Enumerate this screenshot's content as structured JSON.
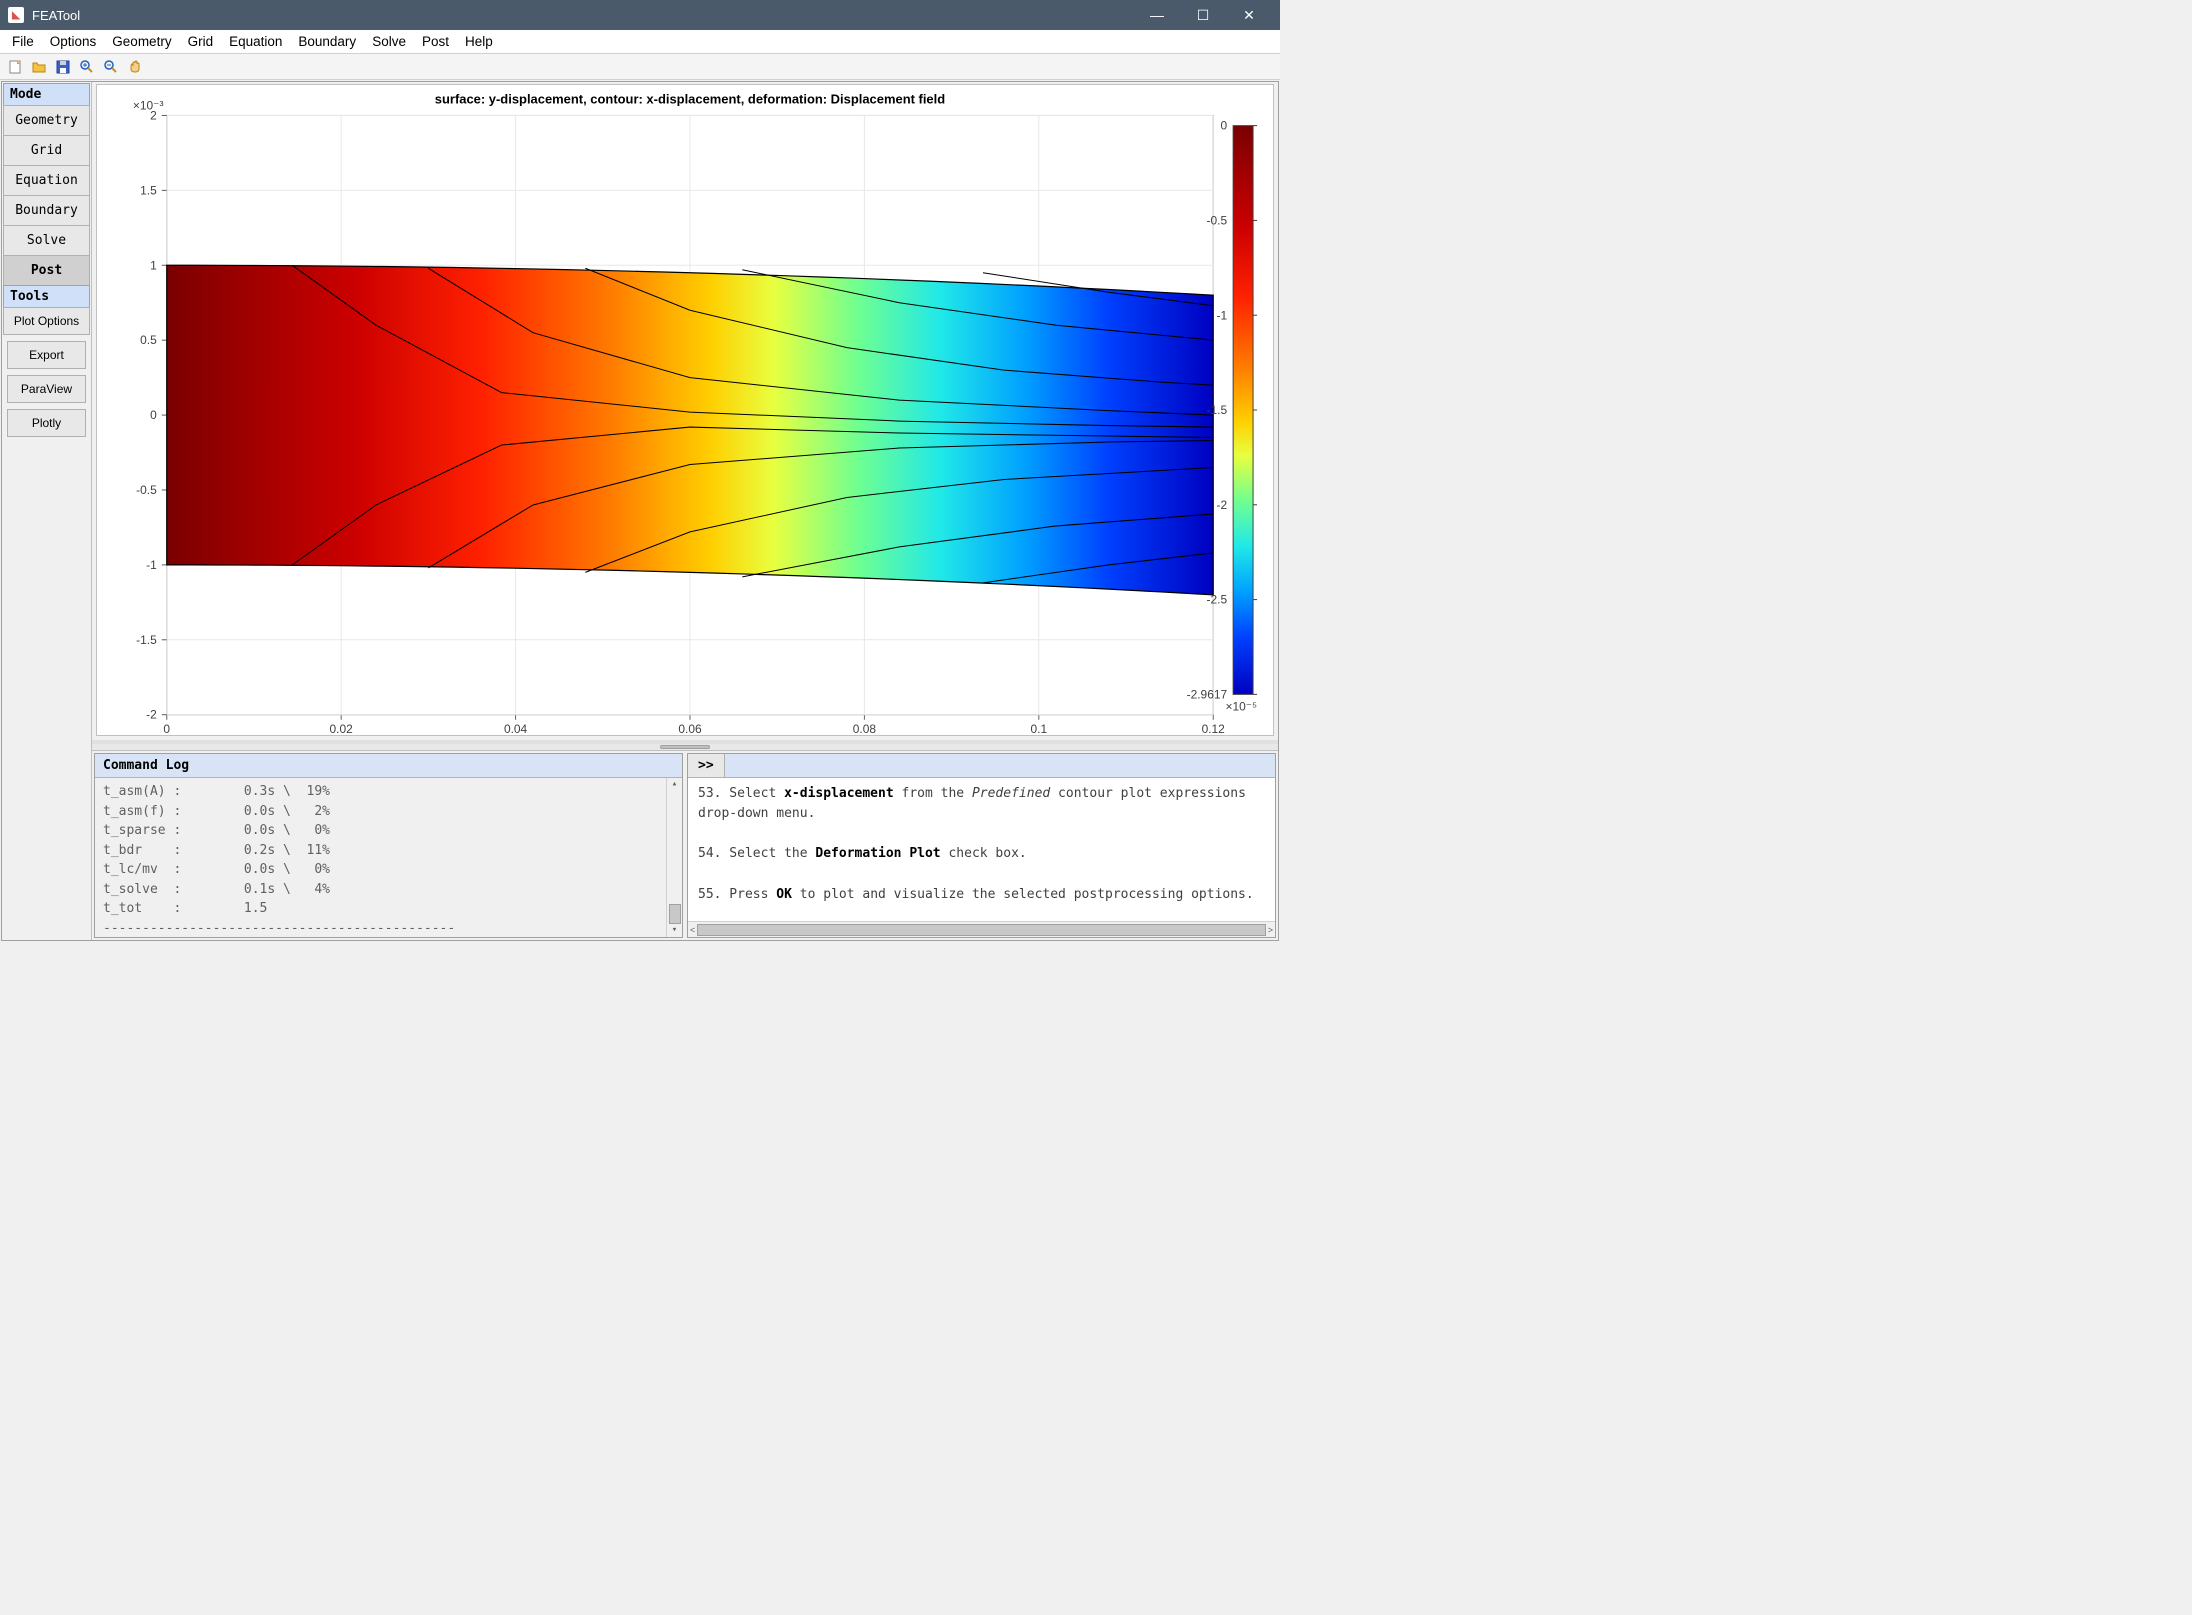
{
  "window": {
    "title": "FEATool"
  },
  "menu": [
    "File",
    "Options",
    "Geometry",
    "Grid",
    "Equation",
    "Boundary",
    "Solve",
    "Post",
    "Help"
  ],
  "sidebar": {
    "mode_label": "Mode",
    "modes": [
      "Geometry",
      "Grid",
      "Equation",
      "Boundary",
      "Solve",
      "Post"
    ],
    "active_mode": "Post",
    "tools_label": "Tools",
    "tools": [
      "Plot Options",
      "Export",
      "ParaView",
      "Plotly"
    ]
  },
  "plot": {
    "title": "surface: y-displacement, contour: x-displacement, deformation: Displacement field",
    "y_exponent": "×10⁻³",
    "cb_exponent": "×10⁻⁵",
    "x_ticks": [
      "0",
      "0.02",
      "0.04",
      "0.06",
      "0.08",
      "0.1",
      "0.12"
    ],
    "y_ticks": [
      "-2",
      "-1.5",
      "-1",
      "-0.5",
      "0",
      "0.5",
      "1",
      "1.5",
      "2"
    ],
    "cb_ticks": [
      "0",
      "-0.5",
      "-1",
      "-1.5",
      "-2",
      "-2.5",
      "-2.9617"
    ]
  },
  "command_log": {
    "header": "Command Log",
    "lines": [
      "t_asm(A) :        0.3s \\  19%",
      "t_asm(f) :        0.0s \\   2%",
      "t_sparse :        0.0s \\   0%",
      "t_bdr    :        0.2s \\  11%",
      "t_lc/mv  :        0.0s \\   0%",
      "t_solve  :        0.1s \\   4%",
      "t_tot    :        1.5",
      "---------------------------------------------"
    ]
  },
  "prompt": ">>",
  "help": {
    "p1_pre": "53. Select ",
    "p1_bold": "x-displacement",
    "p1_mid": " from the ",
    "p1_ital": "Predefined",
    "p1_post": " contour plot expressions drop-down menu.",
    "p2_pre": "54. Select the ",
    "p2_bold": "Deformation Plot",
    "p2_post": " check box.",
    "p3_pre": "55. Press ",
    "p3_bold": "OK",
    "p3_post": " to plot and visualize the selected postprocessing options."
  },
  "chart_data": {
    "type": "heatmap",
    "title": "surface: y-displacement, contour: x-displacement, deformation: Displacement field",
    "xlabel": "",
    "ylabel": "",
    "xlim": [
      0,
      0.12
    ],
    "ylim": [
      -0.002,
      0.002
    ],
    "colorbar_range": [
      -2.9617e-05,
      0
    ],
    "description": "Deformed beam colored by y-displacement with x-displacement isocontours",
    "x_ticks": [
      0,
      0.02,
      0.04,
      0.06,
      0.08,
      0.1,
      0.12
    ],
    "y_ticks": [
      -0.002,
      -0.0015,
      -0.001,
      -0.0005,
      0,
      0.0005,
      0.001,
      0.0015,
      0.002
    ],
    "colorbar_ticks": [
      0,
      -5e-06,
      -1e-05,
      -1.5e-05,
      -2e-05,
      -2.5e-05,
      -2.9617e-05
    ]
  }
}
